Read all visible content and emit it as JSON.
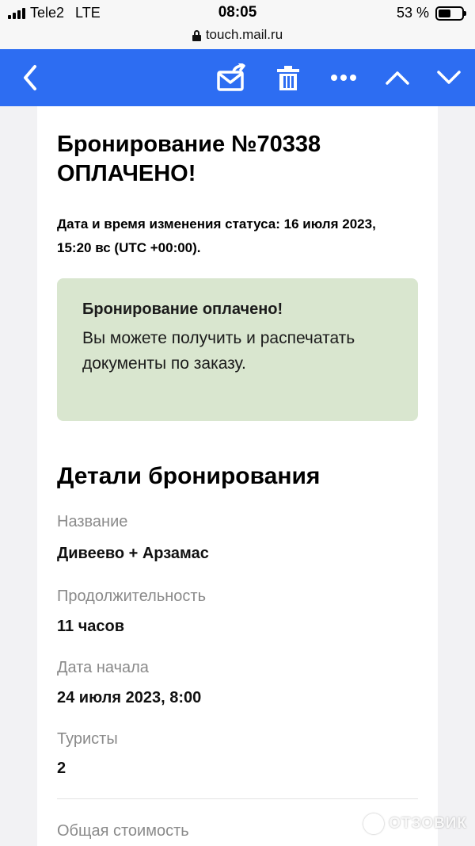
{
  "status_bar": {
    "carrier": "Tele2",
    "network": "LTE",
    "time": "08:05",
    "battery_percent": "53 %",
    "battery_level": 0.53,
    "url": "touch.mail.ru"
  },
  "toolbar": {
    "back_icon": "chevron-left-icon",
    "forward_icon": "mail-forward-icon",
    "delete_icon": "trash-icon",
    "more_icon": "more-icon",
    "prev_icon": "chevron-up-icon",
    "next_icon": "chevron-down-icon",
    "accent_color": "#2d6df2"
  },
  "email": {
    "title": "Бронирование №70338 ОПЛАЧЕНО!",
    "status_changed": "Дата и время изменения статуса: 16 июля 2023, 15:20 вс (UTC +00:00).",
    "notice": {
      "title": "Бронирование оплачено!",
      "text": "Вы можете получить и распечатать документы по заказу.",
      "background": "#d9e6cf"
    },
    "details_title": "Детали бронирования",
    "fields": [
      {
        "label": "Название",
        "value": "Дивеево + Арзамас"
      },
      {
        "label": "Продолжительность",
        "value": "11 часов"
      },
      {
        "label": "Дата начала",
        "value": "24 июля 2023, 8:00"
      },
      {
        "label": "Туристы",
        "value": "2"
      }
    ],
    "total_label": "Общая стоимость"
  },
  "watermark": {
    "text": "ОТЗОВИК"
  }
}
